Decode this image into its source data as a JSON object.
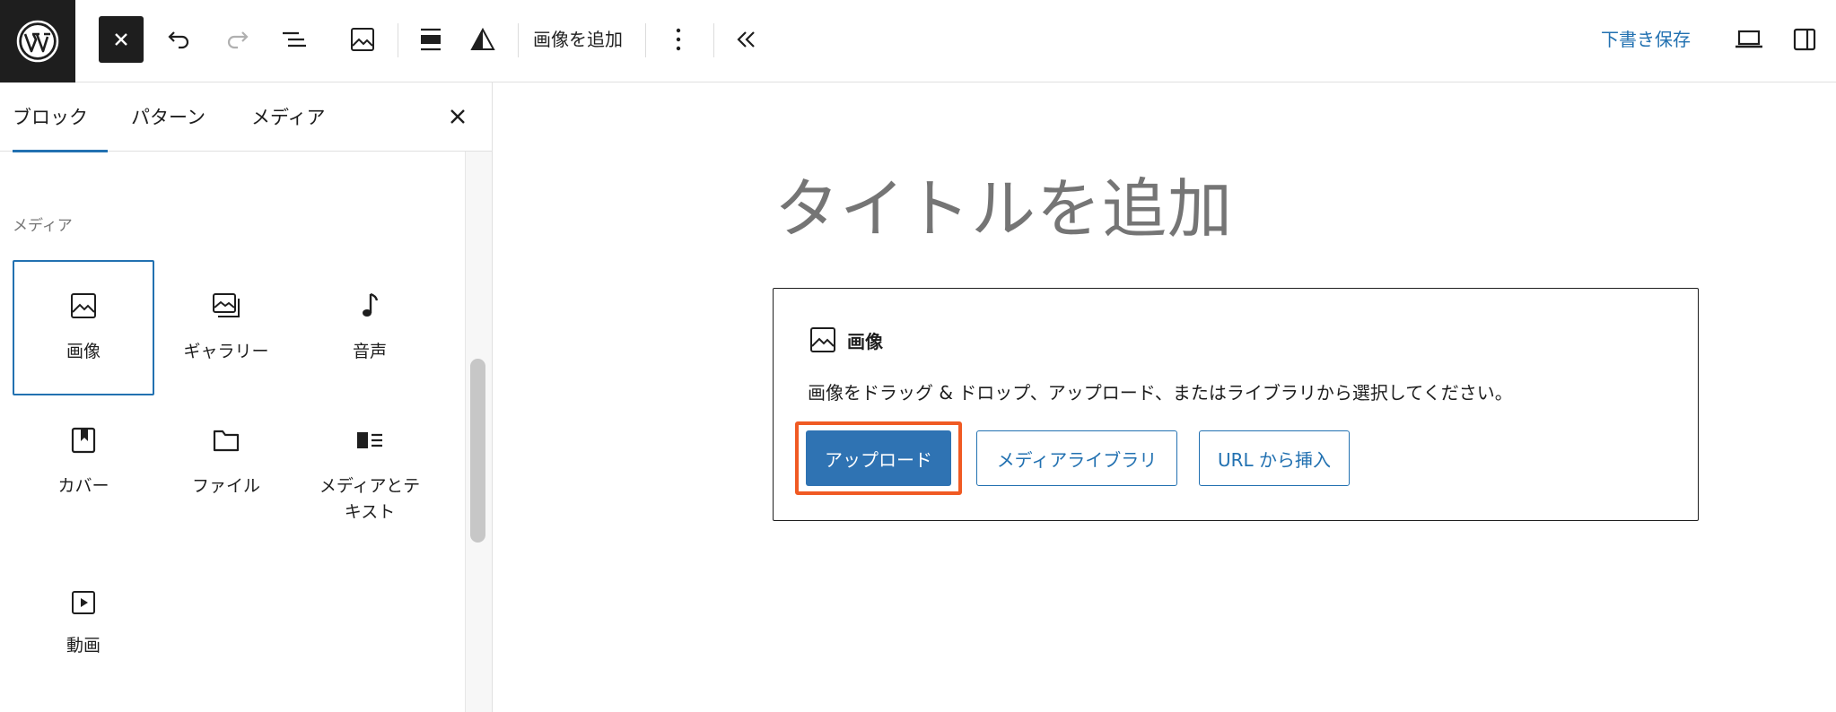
{
  "toolbar": {
    "add_image_label": "画像を追加",
    "save_draft_label": "下書き保存"
  },
  "sidebar": {
    "tabs": [
      {
        "label": "ブロック",
        "active": true
      },
      {
        "label": "パターン",
        "active": false
      },
      {
        "label": "メディア",
        "active": false
      }
    ],
    "section_heading": "メディア",
    "blocks": [
      {
        "label": "画像",
        "icon": "image-icon",
        "selected": true
      },
      {
        "label": "ギャラリー",
        "icon": "gallery-icon",
        "selected": false
      },
      {
        "label": "音声",
        "icon": "audio-icon",
        "selected": false
      },
      {
        "label": "カバー",
        "icon": "cover-icon",
        "selected": false
      },
      {
        "label": "ファイル",
        "icon": "file-icon",
        "selected": false
      },
      {
        "label": "メディアとテキスト",
        "icon": "media-text-icon",
        "selected": false
      },
      {
        "label": "動画",
        "icon": "video-icon",
        "selected": false
      }
    ]
  },
  "editor": {
    "title_placeholder": "タイトルを追加",
    "image_block": {
      "title": "画像",
      "instructions": "画像をドラッグ & ドロップ、アップロード、またはライブラリから選択してください。",
      "upload_label": "アップロード",
      "media_library_label": "メディアライブラリ",
      "insert_url_label": "URL から挿入"
    }
  },
  "colors": {
    "accent": "#2271b1",
    "primary_button": "#2f73b3",
    "highlight": "#f05a23",
    "dark": "#1e1e1e"
  }
}
